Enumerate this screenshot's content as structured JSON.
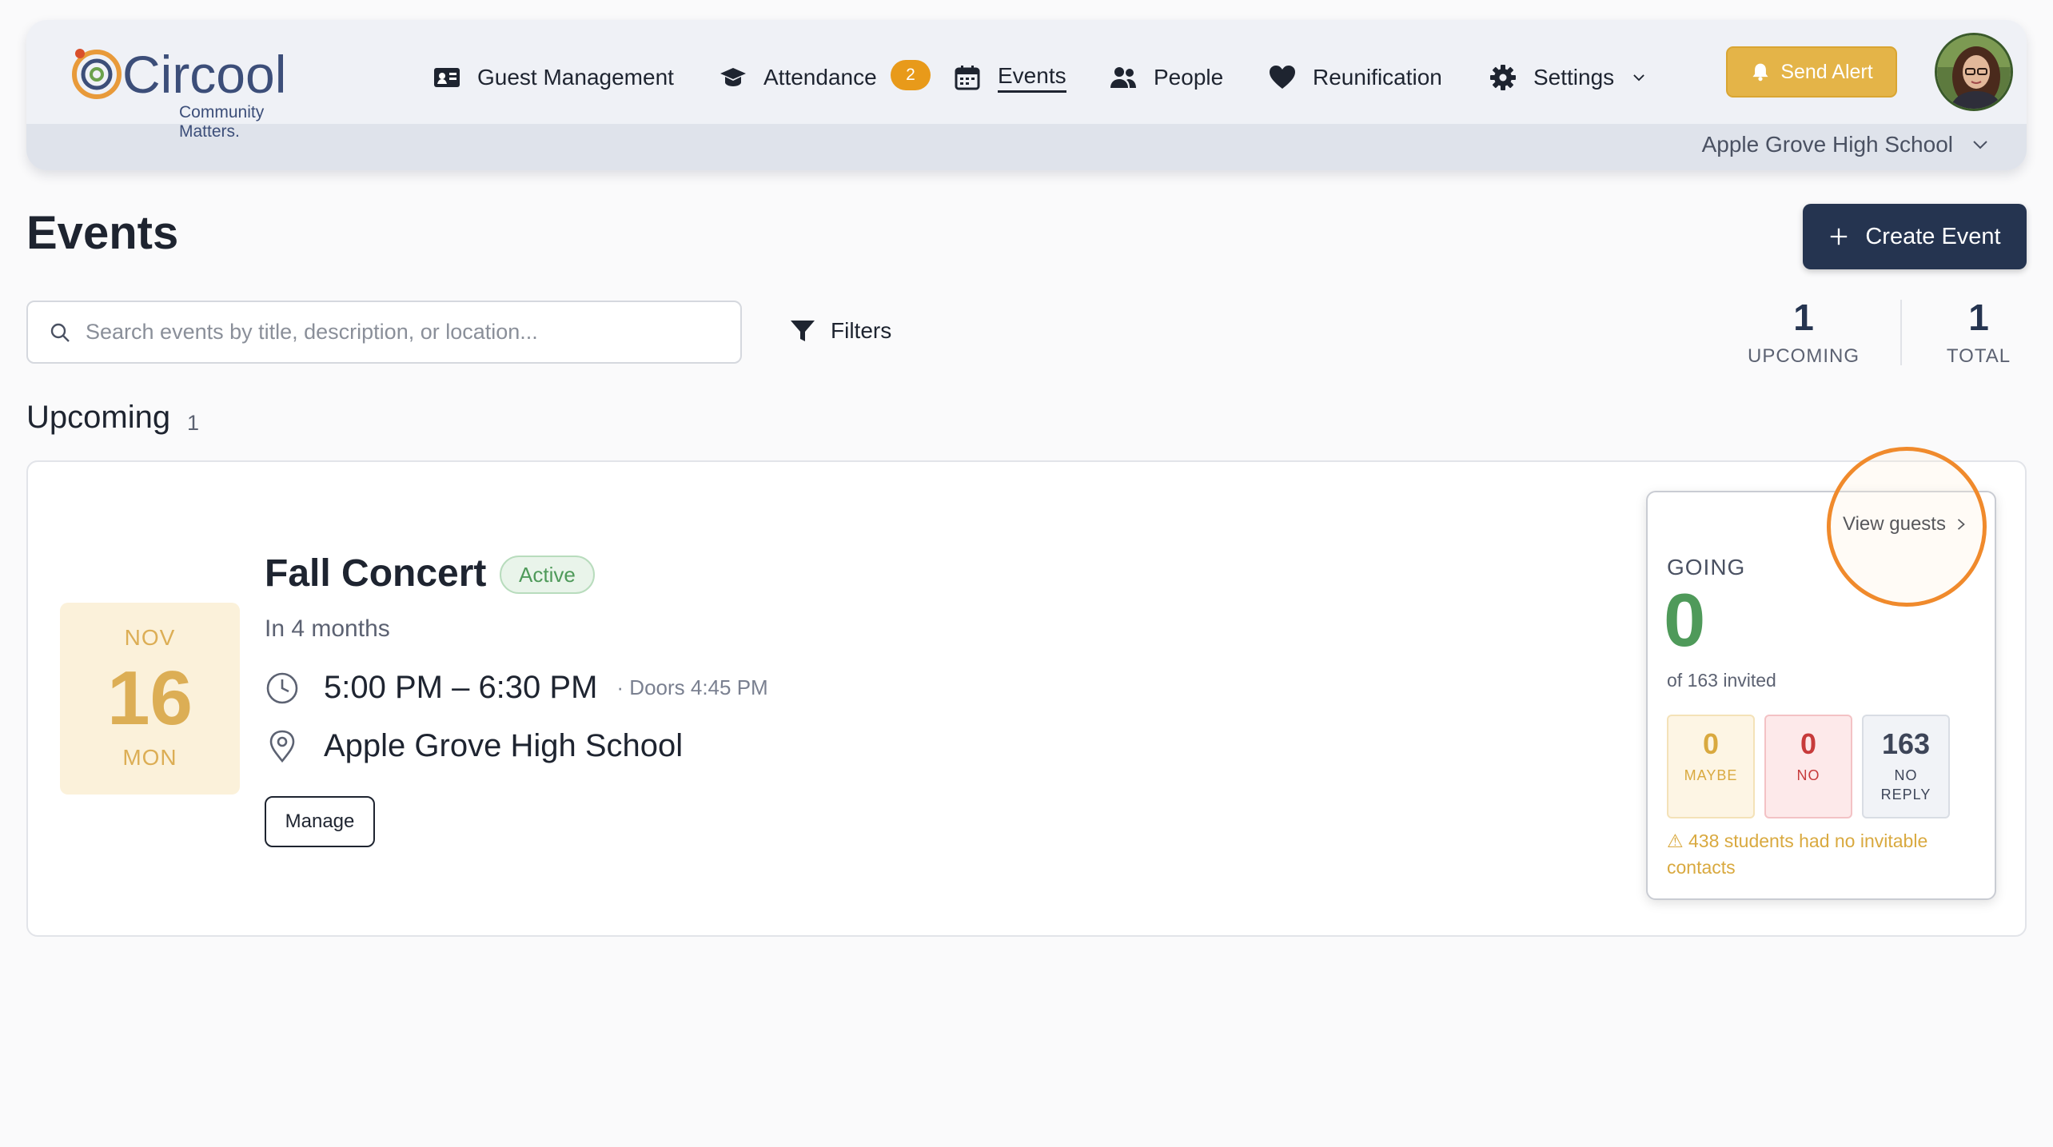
{
  "header": {
    "logo_name": "Circool",
    "logo_tagline": "Community Matters.",
    "nav": [
      {
        "label": "Guest Management",
        "icon": "id-card-icon"
      },
      {
        "label": "Attendance",
        "icon": "graduation-cap-icon",
        "badge": "2"
      },
      {
        "label": "Events",
        "icon": "calendar-icon",
        "active": true
      },
      {
        "label": "People",
        "icon": "people-icon"
      },
      {
        "label": "Reunification",
        "icon": "heart-icon"
      },
      {
        "label": "Settings",
        "icon": "gear-icon"
      }
    ],
    "send_alert_label": "Send Alert",
    "school": "Apple Grove High School"
  },
  "page": {
    "title": "Events",
    "create_label": "Create Event",
    "search_placeholder": "Search events by title, description, or location...",
    "filters_label": "Filters",
    "stats": {
      "upcoming_value": "1",
      "upcoming_label": "UPCOMING",
      "total_value": "1",
      "total_label": "TOTAL"
    },
    "section_title": "Upcoming",
    "section_count": "1"
  },
  "event": {
    "month": "NOV",
    "day": "16",
    "weekday": "MON",
    "title": "Fall Concert",
    "status": "Active",
    "relative": "In 4 months",
    "time": "5:00 PM – 6:30 PM",
    "doors": "· Doors 4:45 PM",
    "location": "Apple Grove High School",
    "manage_label": "Manage",
    "rsvp": {
      "view_guests_label": "View guests",
      "going_label": "GOING",
      "going_value": "0",
      "invited_text": "of 163 invited",
      "maybe_value": "0",
      "maybe_label": "MAYBE",
      "no_value": "0",
      "no_label": "NO",
      "no_reply_value": "163",
      "no_reply_label_1": "NO",
      "no_reply_label_2": "REPLY",
      "warning": "⚠ 438 students had no invitable contacts"
    }
  },
  "colors": {
    "brand_navy": "#253450",
    "alert_yellow": "#e4b448",
    "badge_orange": "#e89a1a",
    "going_green": "#4f9a5a",
    "highlight_orange": "#f08a2c"
  }
}
